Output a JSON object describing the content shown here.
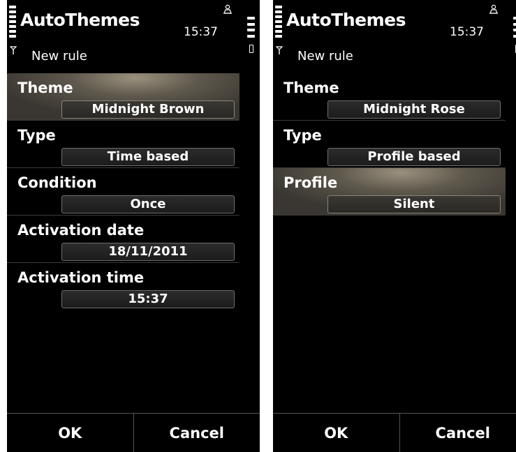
{
  "colors": {
    "screen_background": "#000000",
    "text": "#ffffff",
    "focus_highlight": "#5f594d",
    "separator": "#3a3a3a"
  },
  "screens": [
    {
      "app_title": "AutoThemes",
      "clock": "15:37",
      "subtitle": "New rule",
      "indicators": {
        "signal_icon": "antenna-icon",
        "profile_icon": "person-icon",
        "battery_icon": "battery-icon"
      },
      "items": [
        {
          "label": "Theme",
          "value": "Midnight Brown",
          "focused": true
        },
        {
          "label": "Type",
          "value": "Time based",
          "focused": false
        },
        {
          "label": "Condition",
          "value": "Once",
          "focused": false
        },
        {
          "label": "Activation date",
          "value": "18/11/2011",
          "focused": false
        },
        {
          "label": "Activation time",
          "value": "15:37",
          "focused": false
        }
      ],
      "softkeys": {
        "left": "OK",
        "right": "Cancel"
      }
    },
    {
      "app_title": "AutoThemes",
      "clock": "15:37",
      "subtitle": "New rule",
      "indicators": {
        "signal_icon": "antenna-icon",
        "profile_icon": "person-icon",
        "battery_icon": "battery-icon"
      },
      "items": [
        {
          "label": "Theme",
          "value": "Midnight Rose",
          "focused": false
        },
        {
          "label": "Type",
          "value": "Profile based",
          "focused": false
        },
        {
          "label": "Profile",
          "value": "Silent",
          "focused": true
        }
      ],
      "softkeys": {
        "left": "OK",
        "right": "Cancel"
      }
    }
  ]
}
